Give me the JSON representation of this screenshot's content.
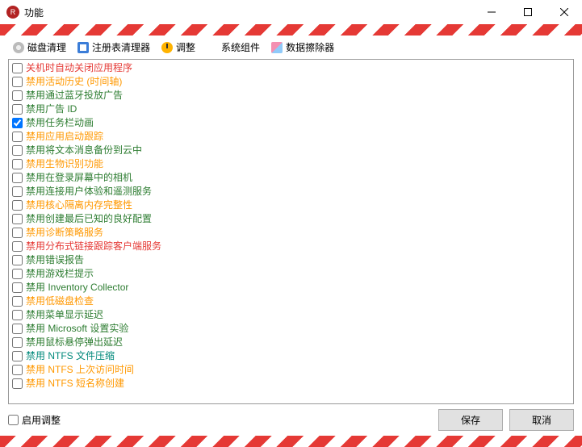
{
  "window": {
    "title": "功能"
  },
  "toolbar": {
    "disk": "磁盘清理",
    "registry": "注册表清理器",
    "adjust": "调整",
    "system": "系统组件",
    "eraser": "数据擦除器"
  },
  "list": [
    {
      "label": "关机时自动关闭应用程序",
      "color": "c-red",
      "checked": false
    },
    {
      "label": "禁用活动历史 (时间轴)",
      "color": "c-orange",
      "checked": false
    },
    {
      "label": "禁用通过蓝牙投放广告",
      "color": "c-green",
      "checked": false
    },
    {
      "label": "禁用广告 ID",
      "color": "c-green",
      "checked": false
    },
    {
      "label": "禁用任务栏动画",
      "color": "c-green",
      "checked": true
    },
    {
      "label": "禁用应用启动跟踪",
      "color": "c-orange",
      "checked": false
    },
    {
      "label": "禁用将文本消息备份到云中",
      "color": "c-green",
      "checked": false
    },
    {
      "label": "禁用生物识别功能",
      "color": "c-orange",
      "checked": false
    },
    {
      "label": "禁用在登录屏幕中的相机",
      "color": "c-green",
      "checked": false
    },
    {
      "label": "禁用连接用户体验和遥测服务",
      "color": "c-green",
      "checked": false
    },
    {
      "label": "禁用核心隔离内存完整性",
      "color": "c-orange",
      "checked": false
    },
    {
      "label": "禁用创建最后已知的良好配置",
      "color": "c-green",
      "checked": false
    },
    {
      "label": "禁用诊断策略服务",
      "color": "c-orange",
      "checked": false
    },
    {
      "label": "禁用分布式链接跟踪客户端服务",
      "color": "c-red",
      "checked": false
    },
    {
      "label": "禁用错误报告",
      "color": "c-green",
      "checked": false
    },
    {
      "label": "禁用游戏栏提示",
      "color": "c-green",
      "checked": false
    },
    {
      "label": "禁用 Inventory Collector",
      "color": "c-green",
      "checked": false
    },
    {
      "label": "禁用低磁盘检查",
      "color": "c-orange",
      "checked": false
    },
    {
      "label": "禁用菜单显示延迟",
      "color": "c-green",
      "checked": false
    },
    {
      "label": "禁用 Microsoft 设置实验",
      "color": "c-green",
      "checked": false
    },
    {
      "label": "禁用鼠标悬停弹出延迟",
      "color": "c-green",
      "checked": false
    },
    {
      "label": "禁用 NTFS 文件压缩",
      "color": "c-teal",
      "checked": false
    },
    {
      "label": "禁用 NTFS 上次访问时间",
      "color": "c-orange",
      "checked": false
    },
    {
      "label": "禁用 NTFS 短名称创建",
      "color": "c-orange",
      "checked": false
    }
  ],
  "footer": {
    "enable": "启用调整",
    "save": "保存",
    "cancel": "取消"
  }
}
